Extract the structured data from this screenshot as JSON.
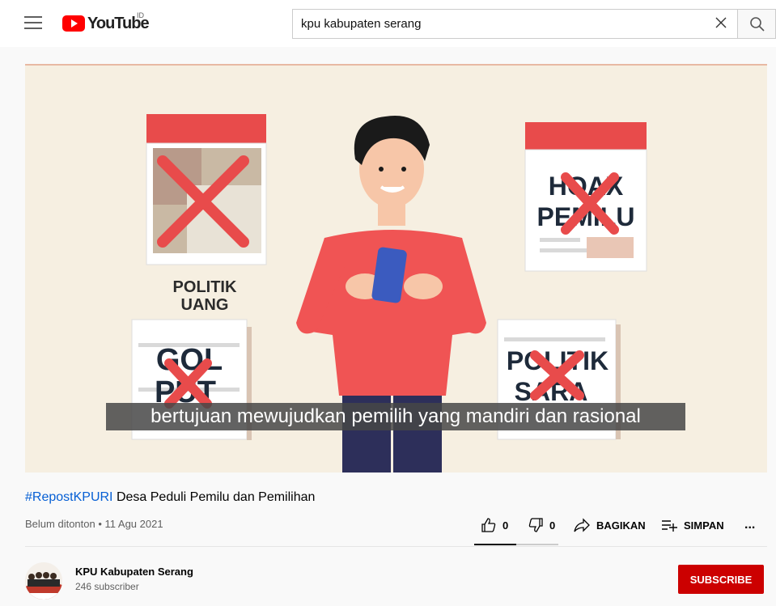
{
  "header": {
    "logo_text": "YouTube",
    "country_code": "ID",
    "search_value": "kpu kabupaten serang"
  },
  "video": {
    "caption": "bertujuan mewujudkan pemilih yang mandiri dan rasional",
    "panels": {
      "politik_uang": "POLITIK\nUANG",
      "hoax_line1": "HOAX",
      "hoax_line2": "PEMILU",
      "golput_line1": "GOL",
      "golput_line2": "PUT",
      "sara_line1": "POLITIK",
      "sara_line2": "SARA"
    }
  },
  "details": {
    "hashtag": "#RepostKPURI",
    "title_rest": " Desa Peduli Pemilu dan Pemilihan",
    "views": "Belum ditonton",
    "separator": " • ",
    "date": "11 Agu 2021",
    "like_count": "0",
    "dislike_count": "0",
    "share_label": "BAGIKAN",
    "save_label": "SIMPAN",
    "more_label": "..."
  },
  "channel": {
    "name": "KPU Kabupaten Serang",
    "subscribers": "246 subscriber",
    "subscribe_label": "SUBSCRIBE"
  },
  "colors": {
    "brand_red": "#ff0000",
    "subscribe_red": "#cc0000",
    "link_blue": "#065fd4",
    "video_bg": "#f6efe1",
    "shirt_red": "#f05454"
  },
  "icons": [
    "menu-icon",
    "youtube-logo-icon",
    "clear-icon",
    "search-icon",
    "like-icon",
    "dislike-icon",
    "share-icon",
    "save-icon",
    "more-icon"
  ]
}
